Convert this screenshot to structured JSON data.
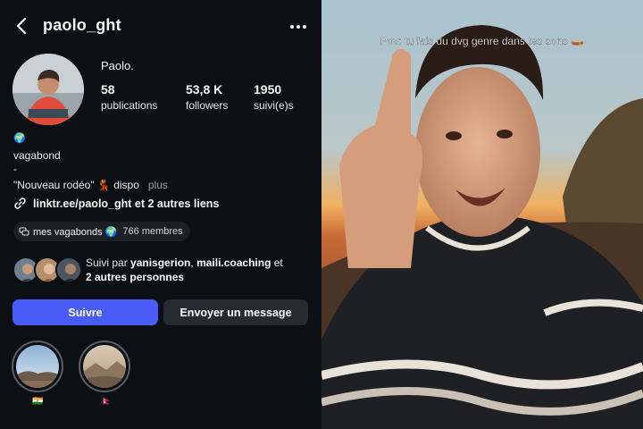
{
  "header": {
    "username": "paolo_ght"
  },
  "profile": {
    "display_name": "Paolo.",
    "stats": [
      {
        "value": "58",
        "label": "publications"
      },
      {
        "value": "53,8 K",
        "label": "followers"
      },
      {
        "value": "1950",
        "label": "suivi(e)s"
      }
    ]
  },
  "bio": {
    "emoji_line": "🌍",
    "line1": "vagabond",
    "line2": "-",
    "line3": "\"Nouveau rodéo\" 💃 dispo",
    "more_label": "plus"
  },
  "links": {
    "text": "linktr.ee/paolo_ght et 2 autres liens"
  },
  "channel": {
    "name": "mes vagabonds 🌍",
    "members": "766 membres"
  },
  "followed_by": {
    "prefix": "Suivi par ",
    "user1": "yanisgerion",
    "sep": ", ",
    "user2": "maili.coaching",
    "mid": " et ",
    "others": "2 autres personnes"
  },
  "buttons": {
    "follow": "Suivre",
    "message": "Envoyer un message"
  },
  "highlights": [
    {
      "label": "🇮🇳"
    },
    {
      "label": "🇳🇵"
    }
  ],
  "video": {
    "caption": "Pov: tu fais du dvg genre dans tes sons 🛶"
  },
  "colors": {
    "follow_button": "#4a5cf7",
    "background": "#0c0f14",
    "secondary_button": "#262a31"
  }
}
